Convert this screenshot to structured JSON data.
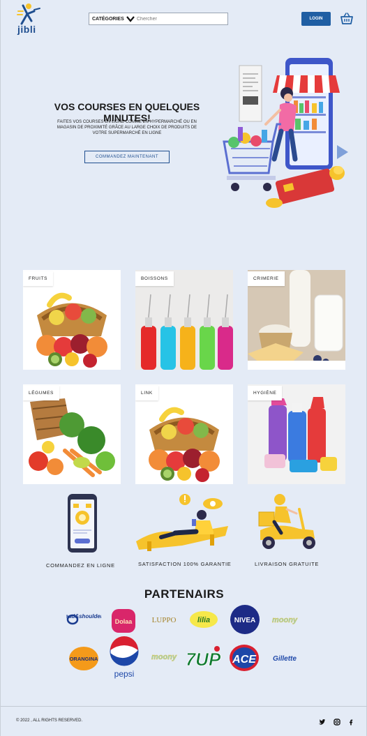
{
  "header": {
    "logo_text": "jibli",
    "categories_label": "CATÉGORIES",
    "search_placeholder": "Chercher",
    "login_label": "LOGIN"
  },
  "hero": {
    "title": "VOS COURSES EN QUELQUES MINUTES!",
    "description": "FAITES VOS COURSES EN LIGNE COMME EN HYPERMARCHÉ OU EN MAGASIN DE PROXIMITÉ GRÂCE AU LARGE CHOIX DE PRODUITS DE VOTRE SUPERMARCHÉ EN LIGNE",
    "cta_label": "COMMANDEZ MAINTENANT"
  },
  "categories": [
    {
      "label": "FRUITS"
    },
    {
      "label": "BOISSONS"
    },
    {
      "label": "CRIMERIE"
    },
    {
      "label": "LÉGUMES"
    },
    {
      "label": "LINK"
    },
    {
      "label": "HYGIÈNE"
    }
  ],
  "features": [
    {
      "label": "COMMANDEZ EN LIGNE"
    },
    {
      "label": "SATISFACTION 100% GARANTIE"
    },
    {
      "label": "LIVRAISON GRATUITE"
    }
  ],
  "partners": {
    "title": "PARTENAIRS",
    "brands": [
      "head&shoulders",
      "Dolaa",
      "LUPPO",
      "lilia",
      "NIVEA",
      "moony",
      "ORANGINA",
      "pepsi",
      "moony",
      "7UP",
      "ACE",
      "Gillette"
    ]
  },
  "footer": {
    "copyright": "© 2022 , ALL RIGHTS RESERVED.",
    "social_icons": [
      "twitter-icon",
      "instagram-icon",
      "facebook-icon"
    ]
  },
  "colors": {
    "background": "#e4ebf6",
    "primary": "#1f5ea3",
    "accent_yellow": "#f6c32c"
  }
}
